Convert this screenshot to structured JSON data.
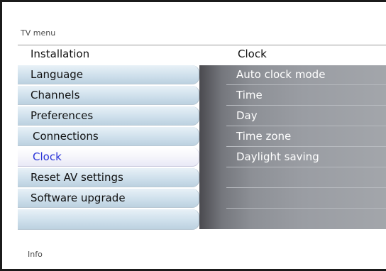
{
  "tv_menu_title": "TV menu",
  "left_header": "Installation",
  "right_header": "Clock",
  "left_menu": [
    {
      "label": "Language"
    },
    {
      "label": "Channels"
    },
    {
      "label": "Preferences"
    },
    {
      "label": "Connections"
    },
    {
      "label": "Clock"
    },
    {
      "label": "Reset AV settings"
    },
    {
      "label": "Software upgrade"
    }
  ],
  "right_menu": [
    {
      "label": "Auto clock mode"
    },
    {
      "label": "Time"
    },
    {
      "label": "Day"
    },
    {
      "label": "Time zone"
    },
    {
      "label": "Daylight saving"
    }
  ],
  "info_label": "Info",
  "colors": {
    "selected_text": "#2a34d8",
    "left_item_bg": "#cfe0ec",
    "right_panel_bg": "#8d9096"
  }
}
